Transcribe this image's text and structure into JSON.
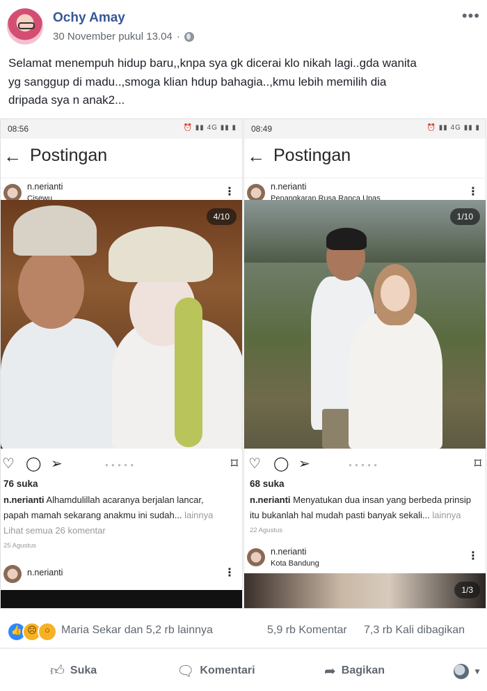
{
  "post": {
    "author": "Ochy Amay",
    "timestamp": "30 November pukul 13.04",
    "privacy_icon": "globe-icon",
    "caption_lines": [
      "Selamat menempuh hidup baru,,knpa sya gk dicerai klo nikah lagi..gda wanita",
      "yg sanggup di madu..,smoga klian hdup bahagia..,kmu lebih memilih dia",
      "dripada sya n anak2..."
    ]
  },
  "left_shot": {
    "time": "08:56",
    "title": "Postingan",
    "username": "n.nerianti",
    "location": "Cisewu",
    "counter": "4/10",
    "likes": "76 suka",
    "caption_user": "n.nerianti",
    "caption_text": " Alhamdulillah acaranya berjalan lancar,",
    "caption_line2": "papah mamah sekarang anakmu ini sudah...",
    "more_label": " lainnya",
    "comments": "Lihat semua 26 komentar",
    "date": "25 Agustus",
    "next_username": "n.nerianti"
  },
  "right_shot": {
    "time": "08:49",
    "title": "Postingan",
    "username": "n.nerianti",
    "location": "Penangkaran Rusa Ranca Upas",
    "counter": "1/10",
    "likes": "68 suka",
    "caption_user": "n.nerianti",
    "caption_text": " Menyatukan dua insan yang berbeda prinsip",
    "caption_line2": "itu  bukanlah hal mudah  pasti banyak sekali...",
    "more_label": " lainnya",
    "date": "22 Agustus",
    "next_username": "n.nerianti",
    "next_location": "Kota Bandung",
    "next_counter": "1/3"
  },
  "reactions": {
    "names": "Maria Sekar dan 5,2 rb lainnya",
    "comments": "5,9 rb Komentar",
    "shares": "7,3 rb Kali dibagikan"
  },
  "buttons": {
    "like": "Suka",
    "comment": "Komentari",
    "share": "Bagikan"
  },
  "colors": {
    "link_blue": "#365899",
    "like_blue": "#2d88ff",
    "reaction_yellow": "#f7b125"
  }
}
